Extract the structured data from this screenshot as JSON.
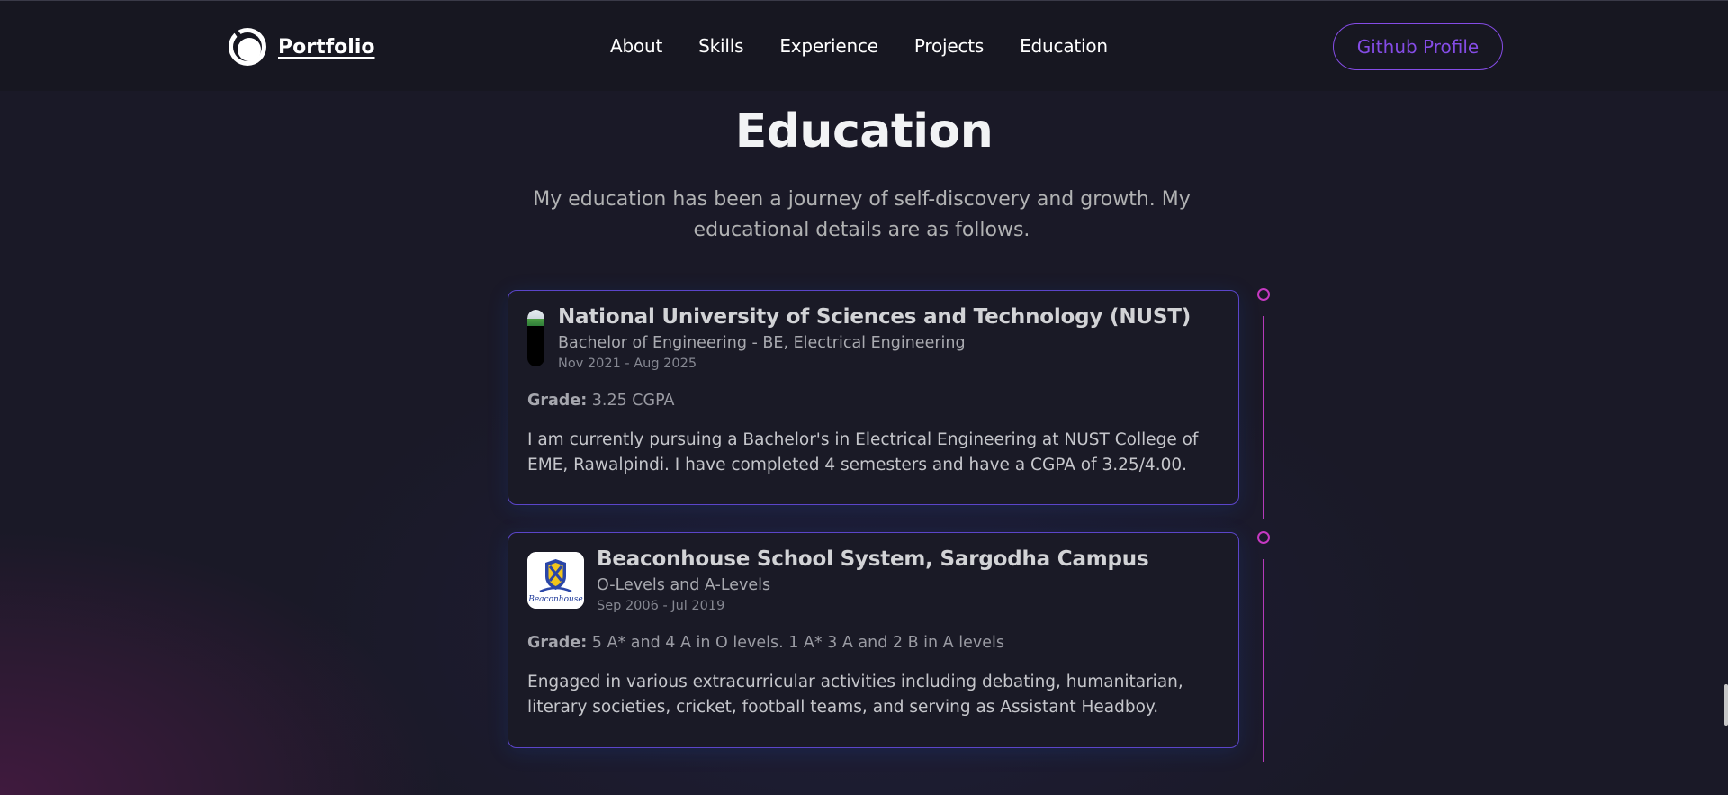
{
  "nav": {
    "brand": "Portfolio",
    "links": [
      "About",
      "Skills",
      "Experience",
      "Projects",
      "Education"
    ],
    "github_label": "Github Profile"
  },
  "section": {
    "title": "Education",
    "description": "My education has been a journey of self-discovery and growth. My educational details are as follows."
  },
  "education": [
    {
      "school": "National University of Sciences and Technology (NUST)",
      "degree": "Bachelor of Engineering - BE, Electrical Engineering",
      "date": "Nov 2021 - Aug 2025",
      "grade_label": "Grade:",
      "grade": "3.25 CGPA",
      "description": "I am currently pursuing a Bachelor's in Electrical Engineering at NUST College of EME, Rawalpindi. I have completed 4 semesters and have a CGPA of 3.25/4.00."
    },
    {
      "school": "Beaconhouse School System, Sargodha Campus",
      "degree": "O-Levels and A-Levels",
      "date": "Sep 2006 - Jul 2019",
      "grade_label": "Grade:",
      "grade": "5 A* and 4 A in O levels. 1 A* 3 A and 2 B in A levels",
      "description": "Engaged in various extracurricular activities including debating, humanitarian, literary societies, cricket, football teams, and serving as Assistant Headboy.",
      "logo_text": "Beaconhouse"
    }
  ],
  "colors": {
    "accent": "#854ce6",
    "timeline": "#c639c2",
    "background": "#1a1927",
    "navbar": "#171721"
  }
}
